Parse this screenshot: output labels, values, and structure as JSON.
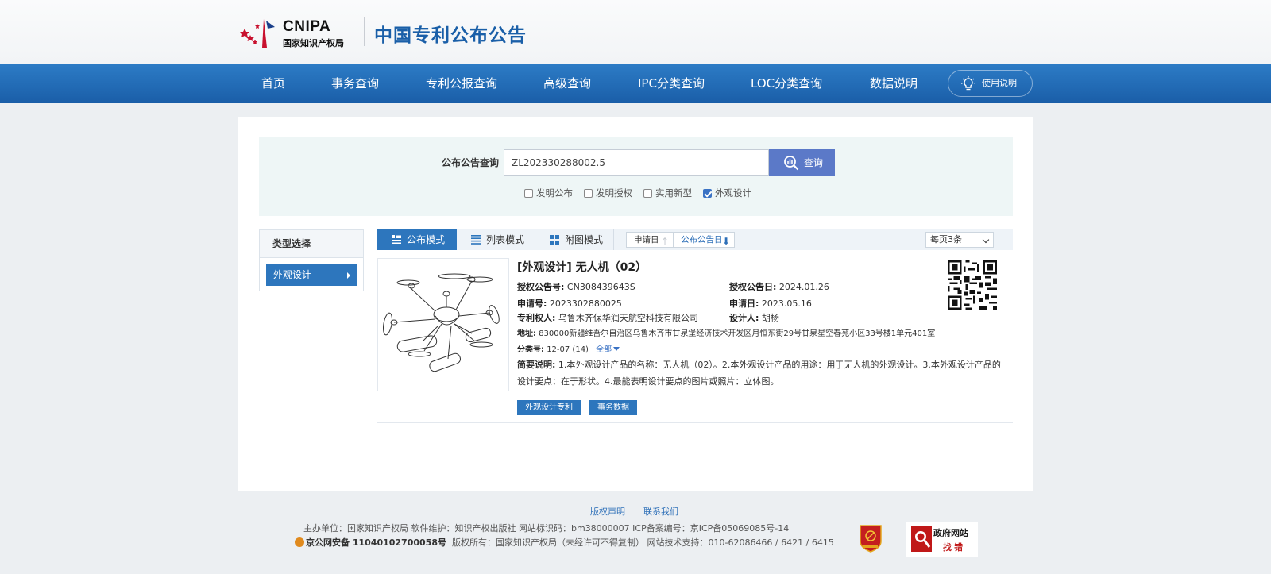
{
  "header": {
    "logo_text": "CNIPA",
    "logo_subtext": "国家知识产权局",
    "site_title": "中国专利公布公告",
    "brand_color": "#1a5fa8"
  },
  "nav": {
    "items": [
      "首页",
      "事务查询",
      "专利公报查询",
      "高级查询",
      "IPC分类查询",
      "LOC分类查询",
      "数据说明"
    ],
    "help_label": "使用说明",
    "bar_color": "#2469b3"
  },
  "search": {
    "label": "公布公告查询",
    "value": "ZL202330288002.5",
    "button_label": "查询",
    "button_color": "#5b79c8",
    "checkboxes": [
      {
        "label": "发明公布",
        "checked": false
      },
      {
        "label": "发明授权",
        "checked": false
      },
      {
        "label": "实用新型",
        "checked": false
      },
      {
        "label": "外观设计",
        "checked": true
      }
    ]
  },
  "sidebar": {
    "title": "类型选择",
    "items": [
      {
        "label": "外观设计",
        "active": true
      }
    ]
  },
  "toolbar": {
    "tabs": [
      {
        "label": "公布模式",
        "active": true,
        "icon": "list-detail-icon"
      },
      {
        "label": "列表模式",
        "active": false,
        "icon": "list-lines-icon"
      },
      {
        "label": "附图模式",
        "active": false,
        "icon": "grid-icon"
      }
    ],
    "sorts": [
      {
        "label": "申请日",
        "arrow": "↑"
      },
      {
        "label": "公布公告日",
        "arrow": "⬇"
      }
    ],
    "per_page": "每页3条"
  },
  "result": {
    "title": "[外观设计] 无人机（02）",
    "grant_no_label": "授权公告号:",
    "grant_no": "CN308439643S",
    "grant_date_label": "授权公告日:",
    "grant_date": "2024.01.26",
    "app_no_label": "申请号:",
    "app_no": "2023302880025",
    "app_date_label": "申请日:",
    "app_date": "2023.05.16",
    "patentee_label": "专利权人:",
    "patentee": "乌鲁木齐保华润天航空科技有限公司",
    "designer_label": "设计人:",
    "designer": "胡杨",
    "address_label": "地址:",
    "address": "830000新疆维吾尔自治区乌鲁木齐市甘泉堡经济技术开发区月恒东街29号甘泉星空春苑小区33号楼1单元401室",
    "class_label": "分类号:",
    "class_no": "12-07 (14)",
    "expand_label": "全部",
    "desc_label": "简要说明:",
    "desc": "1.本外观设计产品的名称：无人机（02）。2.本外观设计产品的用途：用于无人机的外观设计。3.本外观设计产品的设计要点：在于形状。4.最能表明设计要点的图片或照片：立体图。",
    "buttons": [
      "外观设计专利",
      "事务数据"
    ]
  },
  "footer": {
    "links": [
      "版权声明",
      "联系我们"
    ],
    "line1": "主办单位：国家知识产权局    软件维护：知识产权出版社    网站标识码：bm38000007    ICP备案编号：京ICP备05069085号-14",
    "police": "京公网安备 11040102700058号",
    "line2": "版权所有：国家知识产权局（未经许可不得复制）    网站技术支持：010-62086466 / 6421 / 6415",
    "badge_title": "政府网站",
    "badge_sub": "找错"
  }
}
